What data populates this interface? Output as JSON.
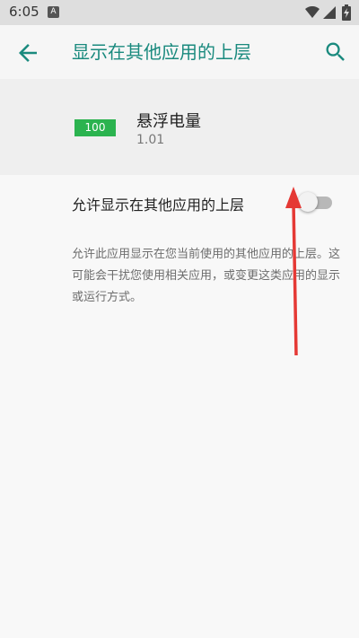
{
  "status_bar": {
    "time": "6:05",
    "notification_icon": "A",
    "icons": [
      "wifi-icon",
      "signal-icon",
      "battery-charging-icon"
    ]
  },
  "app_bar": {
    "title": "显示在其他应用的上层",
    "back_icon": "arrow-back-icon",
    "search_icon": "search-icon",
    "accent_color": "#1a8a7e"
  },
  "app_info": {
    "icon_text": "100",
    "icon_color": "#2bb34f",
    "name": "悬浮电量",
    "version": "1.01"
  },
  "setting": {
    "label": "允许显示在其他应用的上层",
    "enabled": false
  },
  "description": "允许此应用显示在您当前使用的其他应用的上层。这可能会干扰您使用相关应用，或变更这类应用的显示或运行方式。",
  "annotation": {
    "type": "red-arrow",
    "color": "#e53935"
  }
}
